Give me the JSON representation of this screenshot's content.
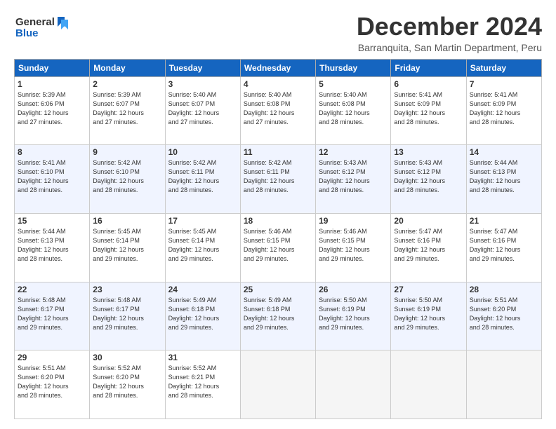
{
  "logo": {
    "line1": "General",
    "line2": "Blue"
  },
  "title": "December 2024",
  "location": "Barranquita, San Martin Department, Peru",
  "days_header": [
    "Sunday",
    "Monday",
    "Tuesday",
    "Wednesday",
    "Thursday",
    "Friday",
    "Saturday"
  ],
  "weeks": [
    [
      {
        "day": "1",
        "info": "Sunrise: 5:39 AM\nSunset: 6:06 PM\nDaylight: 12 hours\nand 27 minutes."
      },
      {
        "day": "2",
        "info": "Sunrise: 5:39 AM\nSunset: 6:07 PM\nDaylight: 12 hours\nand 27 minutes."
      },
      {
        "day": "3",
        "info": "Sunrise: 5:40 AM\nSunset: 6:07 PM\nDaylight: 12 hours\nand 27 minutes."
      },
      {
        "day": "4",
        "info": "Sunrise: 5:40 AM\nSunset: 6:08 PM\nDaylight: 12 hours\nand 27 minutes."
      },
      {
        "day": "5",
        "info": "Sunrise: 5:40 AM\nSunset: 6:08 PM\nDaylight: 12 hours\nand 28 minutes."
      },
      {
        "day": "6",
        "info": "Sunrise: 5:41 AM\nSunset: 6:09 PM\nDaylight: 12 hours\nand 28 minutes."
      },
      {
        "day": "7",
        "info": "Sunrise: 5:41 AM\nSunset: 6:09 PM\nDaylight: 12 hours\nand 28 minutes."
      }
    ],
    [
      {
        "day": "8",
        "info": "Sunrise: 5:41 AM\nSunset: 6:10 PM\nDaylight: 12 hours\nand 28 minutes."
      },
      {
        "day": "9",
        "info": "Sunrise: 5:42 AM\nSunset: 6:10 PM\nDaylight: 12 hours\nand 28 minutes."
      },
      {
        "day": "10",
        "info": "Sunrise: 5:42 AM\nSunset: 6:11 PM\nDaylight: 12 hours\nand 28 minutes."
      },
      {
        "day": "11",
        "info": "Sunrise: 5:42 AM\nSunset: 6:11 PM\nDaylight: 12 hours\nand 28 minutes."
      },
      {
        "day": "12",
        "info": "Sunrise: 5:43 AM\nSunset: 6:12 PM\nDaylight: 12 hours\nand 28 minutes."
      },
      {
        "day": "13",
        "info": "Sunrise: 5:43 AM\nSunset: 6:12 PM\nDaylight: 12 hours\nand 28 minutes."
      },
      {
        "day": "14",
        "info": "Sunrise: 5:44 AM\nSunset: 6:13 PM\nDaylight: 12 hours\nand 28 minutes."
      }
    ],
    [
      {
        "day": "15",
        "info": "Sunrise: 5:44 AM\nSunset: 6:13 PM\nDaylight: 12 hours\nand 28 minutes."
      },
      {
        "day": "16",
        "info": "Sunrise: 5:45 AM\nSunset: 6:14 PM\nDaylight: 12 hours\nand 29 minutes."
      },
      {
        "day": "17",
        "info": "Sunrise: 5:45 AM\nSunset: 6:14 PM\nDaylight: 12 hours\nand 29 minutes."
      },
      {
        "day": "18",
        "info": "Sunrise: 5:46 AM\nSunset: 6:15 PM\nDaylight: 12 hours\nand 29 minutes."
      },
      {
        "day": "19",
        "info": "Sunrise: 5:46 AM\nSunset: 6:15 PM\nDaylight: 12 hours\nand 29 minutes."
      },
      {
        "day": "20",
        "info": "Sunrise: 5:47 AM\nSunset: 6:16 PM\nDaylight: 12 hours\nand 29 minutes."
      },
      {
        "day": "21",
        "info": "Sunrise: 5:47 AM\nSunset: 6:16 PM\nDaylight: 12 hours\nand 29 minutes."
      }
    ],
    [
      {
        "day": "22",
        "info": "Sunrise: 5:48 AM\nSunset: 6:17 PM\nDaylight: 12 hours\nand 29 minutes."
      },
      {
        "day": "23",
        "info": "Sunrise: 5:48 AM\nSunset: 6:17 PM\nDaylight: 12 hours\nand 29 minutes."
      },
      {
        "day": "24",
        "info": "Sunrise: 5:49 AM\nSunset: 6:18 PM\nDaylight: 12 hours\nand 29 minutes."
      },
      {
        "day": "25",
        "info": "Sunrise: 5:49 AM\nSunset: 6:18 PM\nDaylight: 12 hours\nand 29 minutes."
      },
      {
        "day": "26",
        "info": "Sunrise: 5:50 AM\nSunset: 6:19 PM\nDaylight: 12 hours\nand 29 minutes."
      },
      {
        "day": "27",
        "info": "Sunrise: 5:50 AM\nSunset: 6:19 PM\nDaylight: 12 hours\nand 29 minutes."
      },
      {
        "day": "28",
        "info": "Sunrise: 5:51 AM\nSunset: 6:20 PM\nDaylight: 12 hours\nand 28 minutes."
      }
    ],
    [
      {
        "day": "29",
        "info": "Sunrise: 5:51 AM\nSunset: 6:20 PM\nDaylight: 12 hours\nand 28 minutes."
      },
      {
        "day": "30",
        "info": "Sunrise: 5:52 AM\nSunset: 6:20 PM\nDaylight: 12 hours\nand 28 minutes."
      },
      {
        "day": "31",
        "info": "Sunrise: 5:52 AM\nSunset: 6:21 PM\nDaylight: 12 hours\nand 28 minutes."
      },
      {
        "day": "",
        "info": ""
      },
      {
        "day": "",
        "info": ""
      },
      {
        "day": "",
        "info": ""
      },
      {
        "day": "",
        "info": ""
      }
    ]
  ]
}
